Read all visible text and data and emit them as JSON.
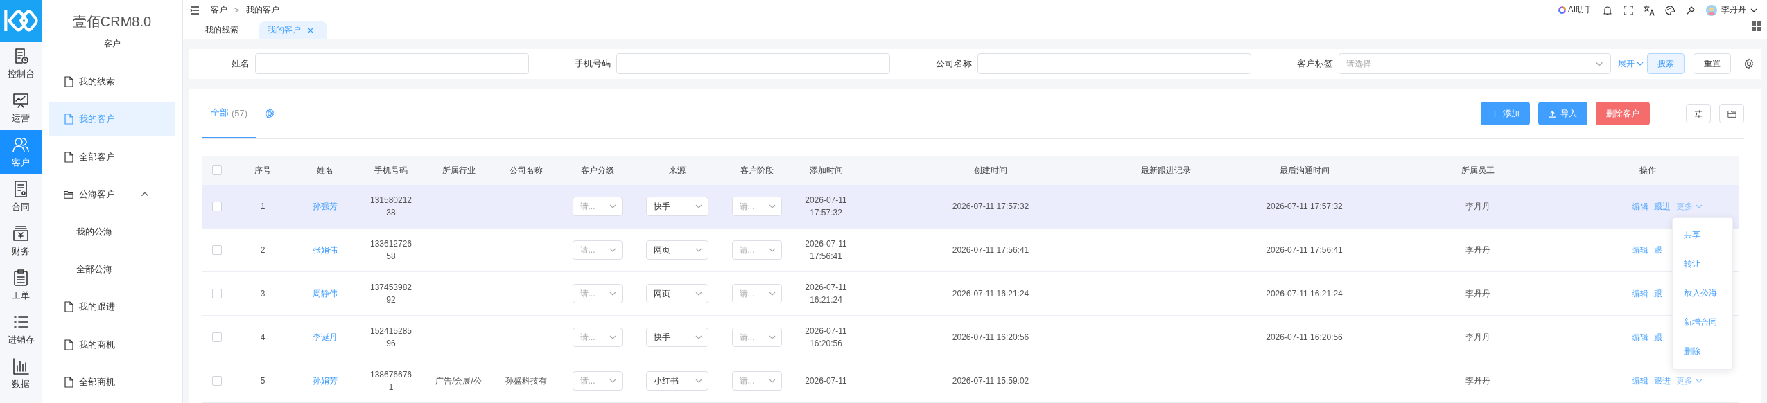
{
  "app": {
    "title": "壹佰CRM8.0",
    "section": "客户"
  },
  "rail": [
    {
      "label": "控制台",
      "selected": false
    },
    {
      "label": "运营",
      "selected": false
    },
    {
      "label": "客户",
      "selected": true
    },
    {
      "label": "合同",
      "selected": false
    },
    {
      "label": "财务",
      "selected": false
    },
    {
      "label": "工单",
      "selected": false
    },
    {
      "label": "进销存",
      "selected": false
    },
    {
      "label": "数据",
      "selected": false
    }
  ],
  "menu": [
    {
      "kind": "page",
      "label": "我的线索",
      "selected": false
    },
    {
      "kind": "page",
      "label": "我的客户",
      "selected": true
    },
    {
      "kind": "page",
      "label": "全部客户",
      "selected": false
    },
    {
      "kind": "folder",
      "label": "公海客户",
      "expanded": true,
      "children": [
        {
          "label": "我的公海",
          "selected": false
        },
        {
          "label": "全部公海",
          "selected": false
        }
      ]
    },
    {
      "kind": "page",
      "label": "我的跟进",
      "selected": false
    },
    {
      "kind": "page",
      "label": "我的商机",
      "selected": false
    },
    {
      "kind": "page",
      "label": "全部商机",
      "selected": false
    }
  ],
  "breadcrumb": [
    "客户",
    ">",
    "我的客户"
  ],
  "header": {
    "assistant": "AI助手",
    "user": "李丹丹"
  },
  "page_tabs": [
    {
      "label": "我的线索",
      "selected": false,
      "closable": false
    },
    {
      "label": "我的客户",
      "selected": true,
      "closable": true
    }
  ],
  "filters": [
    {
      "kind": "input",
      "label": "姓名"
    },
    {
      "kind": "input",
      "label": "手机号码"
    },
    {
      "kind": "input",
      "label": "公司名称"
    },
    {
      "kind": "select",
      "label": "客户标签",
      "placeholder": "请选择"
    }
  ],
  "filter_actions": {
    "expand": "展开",
    "search": "搜索",
    "reset": "重置"
  },
  "list_tabs": [
    {
      "label": "全部",
      "count": "(57)",
      "selected": true
    }
  ],
  "toolbar": [
    {
      "kind": "add",
      "label": "添加"
    },
    {
      "kind": "import",
      "label": "导入"
    },
    {
      "kind": "danger",
      "label": "删除客户"
    }
  ],
  "table": {
    "all_checked": false,
    "columns": [
      "序号",
      "姓名",
      "手机号码",
      "所属行业",
      "公司名称",
      "客户分级",
      "来源",
      "客户阶段",
      "添加时间",
      "创建时间",
      "最新跟进记录",
      "最后沟通时间",
      "所属员工",
      "操作"
    ],
    "rows": [
      {
        "checked": false,
        "highlighted": true,
        "no": "1",
        "name": "孙强芳",
        "phone": "13158021238",
        "industry": "",
        "company": "",
        "level": "请...",
        "source": "快手",
        "stage": "请...",
        "added": "2026-07-11 17:57:32",
        "created": "2026-07-11 17:57:32",
        "latest": "",
        "last_contact": "2026-07-11 17:57:32",
        "owner": "李丹丹",
        "actions": [
          {
            "kind": "link",
            "label": "编辑"
          },
          {
            "kind": "link",
            "label": "跟进"
          },
          {
            "kind": "more",
            "label": "更多"
          }
        ]
      },
      {
        "checked": false,
        "highlighted": false,
        "no": "2",
        "name": "张娟伟",
        "phone": "13361272658",
        "industry": "",
        "company": "",
        "level": "请...",
        "source": "网页",
        "stage": "请...",
        "added": "2026-07-11 17:56:41",
        "created": "2026-07-11 17:56:41",
        "latest": "",
        "last_contact": "2026-07-11 17:56:41",
        "owner": "李丹丹",
        "actions": [
          {
            "kind": "link",
            "label": "编辑"
          },
          {
            "kind": "link",
            "label": "跟"
          }
        ]
      },
      {
        "checked": false,
        "highlighted": false,
        "no": "3",
        "name": "周静伟",
        "phone": "13745398292",
        "industry": "",
        "company": "",
        "level": "请...",
        "source": "网页",
        "stage": "请...",
        "added": "2026-07-11 16:21:24",
        "created": "2026-07-11 16:21:24",
        "latest": "",
        "last_contact": "2026-07-11 16:21:24",
        "owner": "李丹丹",
        "actions": [
          {
            "kind": "link",
            "label": "编辑"
          },
          {
            "kind": "link",
            "label": "跟"
          }
        ]
      },
      {
        "checked": false,
        "highlighted": false,
        "no": "4",
        "name": "李诞丹",
        "phone": "15241528596",
        "industry": "",
        "company": "",
        "level": "请...",
        "source": "快手",
        "stage": "请...",
        "added": "2026-07-11 16:20:56",
        "created": "2026-07-11 16:20:56",
        "latest": "",
        "last_contact": "2026-07-11 16:20:56",
        "owner": "李丹丹",
        "actions": [
          {
            "kind": "link",
            "label": "编辑"
          },
          {
            "kind": "link",
            "label": "跟"
          }
        ]
      },
      {
        "checked": false,
        "highlighted": false,
        "no": "5",
        "name": "孙娟芳",
        "phone": "1386766761",
        "industry": "广告/会展/公",
        "company": "孙盛科技有",
        "level": "请...",
        "source": "小红书",
        "stage": "请...",
        "added": "2026-07-11",
        "created": "2026-07-11 15:59:02",
        "latest": "",
        "last_contact": "",
        "owner": "李丹丹",
        "actions": [
          {
            "kind": "link",
            "label": "编辑"
          },
          {
            "kind": "link",
            "label": "跟进"
          },
          {
            "kind": "more",
            "label": "更多"
          }
        ]
      }
    ]
  },
  "more_menu": [
    "共享",
    "转让",
    "放入公海",
    "新增合同",
    "删除"
  ]
}
